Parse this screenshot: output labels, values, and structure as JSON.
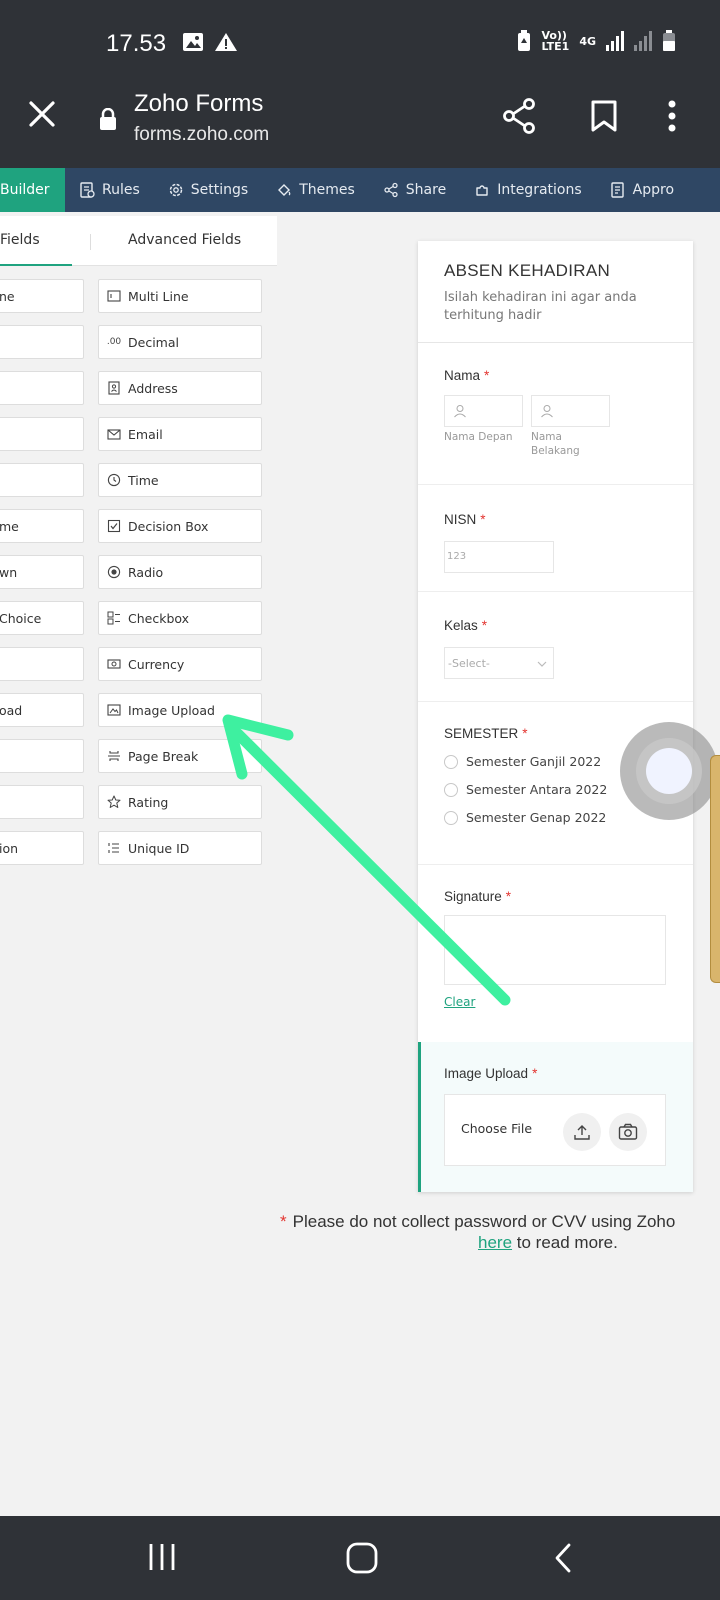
{
  "status_bar": {
    "time": "17.53",
    "network_top": "Vo))",
    "network_bottom": "LTE1",
    "network_type": "4G"
  },
  "browser": {
    "site_title": "Zoho Forms",
    "site_url": "forms.zoho.com"
  },
  "nav": {
    "items": [
      {
        "label": "Builder",
        "icon": "builder-icon"
      },
      {
        "label": "Rules",
        "icon": "rules-icon"
      },
      {
        "label": "Settings",
        "icon": "gear-icon"
      },
      {
        "label": "Themes",
        "icon": "paint-bucket-icon"
      },
      {
        "label": "Share",
        "icon": "share-icon"
      },
      {
        "label": "Integrations",
        "icon": "puzzle-icon"
      },
      {
        "label": "Appro",
        "icon": "approval-icon"
      }
    ]
  },
  "field_panel": {
    "tab_standard": "Fields",
    "tab_advanced": "Advanced Fields",
    "left_fields": [
      "ne",
      "",
      "",
      "",
      "",
      "me",
      "wn",
      " Choice",
      "",
      "oad",
      "",
      "",
      "ion"
    ],
    "right_fields": [
      {
        "label": "Multi Line",
        "icon": "multi-line-icon"
      },
      {
        "label": "Decimal",
        "icon": "decimal-icon",
        "glyph": ".00"
      },
      {
        "label": "Address",
        "icon": "address-icon"
      },
      {
        "label": "Email",
        "icon": "email-icon"
      },
      {
        "label": "Time",
        "icon": "clock-icon"
      },
      {
        "label": "Decision Box",
        "icon": "checkbox-checked-icon"
      },
      {
        "label": "Radio",
        "icon": "radio-icon"
      },
      {
        "label": "Checkbox",
        "icon": "checkbox-list-icon"
      },
      {
        "label": "Currency",
        "icon": "currency-icon"
      },
      {
        "label": "Image Upload",
        "icon": "image-icon"
      },
      {
        "label": "Page Break",
        "icon": "page-break-icon"
      },
      {
        "label": "Rating",
        "icon": "star-icon"
      },
      {
        "label": "Unique ID",
        "icon": "unique-id-icon"
      }
    ]
  },
  "form": {
    "title": "ABSEN KEHADIRAN",
    "description": "Isilah kehadiran ini agar anda terhitung hadir",
    "nama": {
      "label": "Nama",
      "required": "*",
      "first_sub": "Nama Depan",
      "last_sub_1": "Nama",
      "last_sub_2": "Belakang"
    },
    "nisn": {
      "label": "NISN",
      "required": "*",
      "placeholder": "123"
    },
    "kelas": {
      "label": "Kelas",
      "required": "*",
      "placeholder": "-Select-"
    },
    "semester": {
      "label": "SEMESTER",
      "required": "*",
      "options": [
        "Semester Ganjil 2022",
        "Semester Antara 2022",
        "Semester Genap 2022"
      ]
    },
    "signature": {
      "label": "Signature",
      "required": "*",
      "clear": "Clear"
    },
    "image_upload": {
      "label": "Image Upload",
      "required": "*",
      "choose": "Choose File"
    }
  },
  "notice": {
    "star": "*",
    "text": "Please do not collect password or CVV using Zoho",
    "link": "here",
    "after_link": " to read more."
  },
  "colors": {
    "accent": "#1fa37f",
    "nav_bg": "#2f4764",
    "system_bar": "#2f3237",
    "annotation_arrow": "#3ef0a0",
    "required": "#e3342f"
  }
}
